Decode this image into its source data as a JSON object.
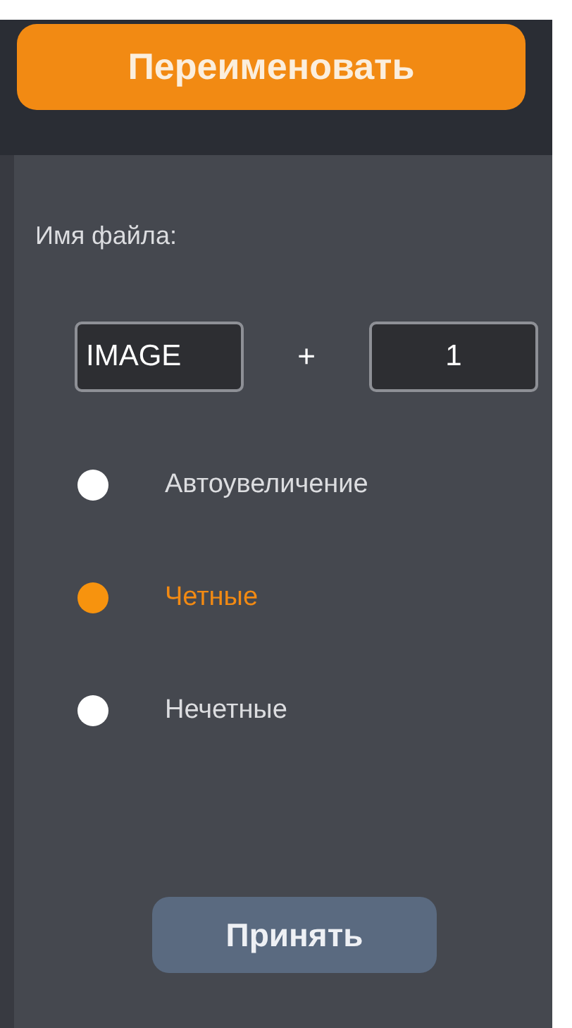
{
  "rename_button": {
    "label": "Переименовать"
  },
  "filename_label": "Имя файла:",
  "name_field": {
    "value": "IMAGE"
  },
  "plus": "+",
  "number_field": {
    "value": "1"
  },
  "options": [
    {
      "label": "Автоувеличение",
      "selected": false
    },
    {
      "label": "Четные",
      "selected": true
    },
    {
      "label": "Нечетные",
      "selected": false
    }
  ],
  "accept_button": {
    "label": "Принять"
  }
}
